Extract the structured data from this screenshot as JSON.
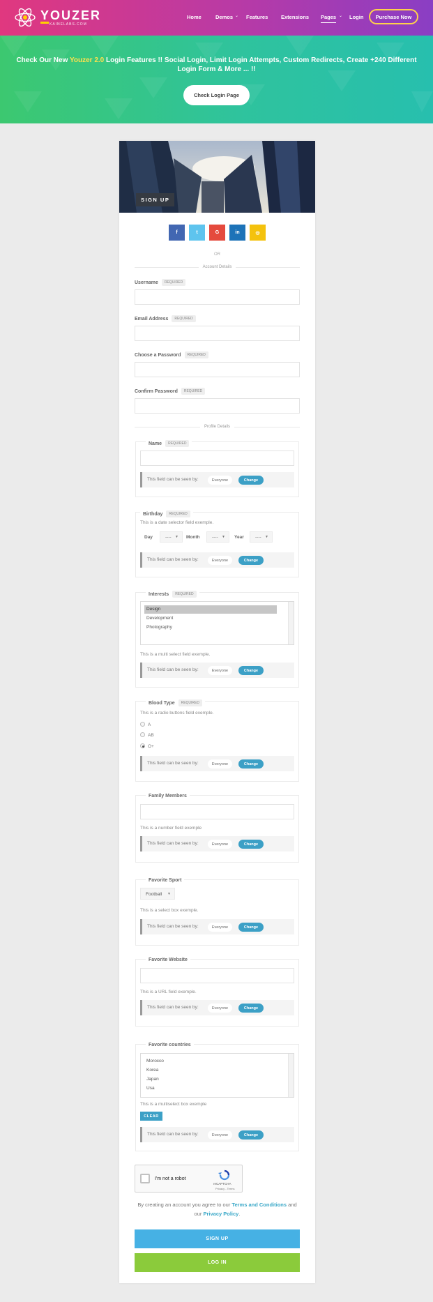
{
  "header": {
    "logo": {
      "word": "YOUZER",
      "sub": "KAINELABS.COM"
    },
    "nav": [
      {
        "label": "Home"
      },
      {
        "label": "Demos"
      },
      {
        "label": "Features"
      },
      {
        "label": "Extensions"
      },
      {
        "label": "Pages"
      },
      {
        "label": "Login"
      }
    ],
    "purchase": "Purchase Now"
  },
  "banner": {
    "pre": "Check Our New ",
    "highlight": "Youzer 2.0",
    "post": " Login Features !! Social Login, Limit Login Attempts, Custom Redirects, Create +240 Different Login Form & More ... !!",
    "button": "Check Login Page"
  },
  "form": {
    "cover_title": "SIGN UP",
    "social": [
      {
        "label": "f",
        "icon": "facebook-icon",
        "color": "#4267b2"
      },
      {
        "label": "t",
        "icon": "twitter-icon",
        "color": "#5ec4ee"
      },
      {
        "label": "G",
        "icon": "google-icon",
        "color": "#e54a3d"
      },
      {
        "label": "in",
        "icon": "linkedin-icon",
        "color": "#1d73b8"
      },
      {
        "label": "◎",
        "icon": "instagram-icon",
        "color": "#f4c20d"
      }
    ],
    "or": "OR",
    "account_section": "Account Details",
    "required": "REQUIRED",
    "username_label": "Username",
    "email_label": "Email Address",
    "password_label": "Choose a Password",
    "confirm_label": "Confirm Password",
    "profile_section": "Profile Details",
    "visibility": {
      "text": "This field can be seen by:",
      "value": "Everyone",
      "change": "Change"
    },
    "name": {
      "label": "Name"
    },
    "birthday": {
      "label": "Birthday",
      "desc": "This is a date selector field exemple.",
      "day": "Day",
      "month": "Month",
      "year": "Year",
      "placeholder": "----"
    },
    "interests": {
      "label": "Interests",
      "options": [
        "Design",
        "Development",
        "Photography"
      ],
      "selected": "Design",
      "desc": "This is a multi select field exemple."
    },
    "blood": {
      "label": "Blood Type",
      "desc": "This is a radio buttons field exemple.",
      "options": [
        "A",
        "AB",
        "O+"
      ],
      "selected": "O+"
    },
    "family": {
      "label": "Family Members",
      "desc": "This is a number field exemple"
    },
    "sport": {
      "label": "Favorite Sport",
      "value": "Football",
      "desc": "This is a select box exemple."
    },
    "website": {
      "label": "Favorite Website",
      "desc": "This is a URL field exemple."
    },
    "countries": {
      "label": "Favorite countries",
      "options": [
        "Morocco",
        "Korea",
        "Japan",
        "Usa"
      ],
      "desc": "This is a multiselect box exemple",
      "clear": "CLEAR"
    },
    "captcha": {
      "text": "I'm not a robot",
      "brand": "reCAPTCHA",
      "links": "Privacy - Terms"
    },
    "terms": {
      "pre": "By creating an account you agree to our ",
      "terms_link": "Terms and Conditions",
      "mid": " and our ",
      "privacy_link": "Privacy Policy",
      "post": "."
    },
    "signup_button": "SIGN UP",
    "login_button": "LOG IN"
  }
}
